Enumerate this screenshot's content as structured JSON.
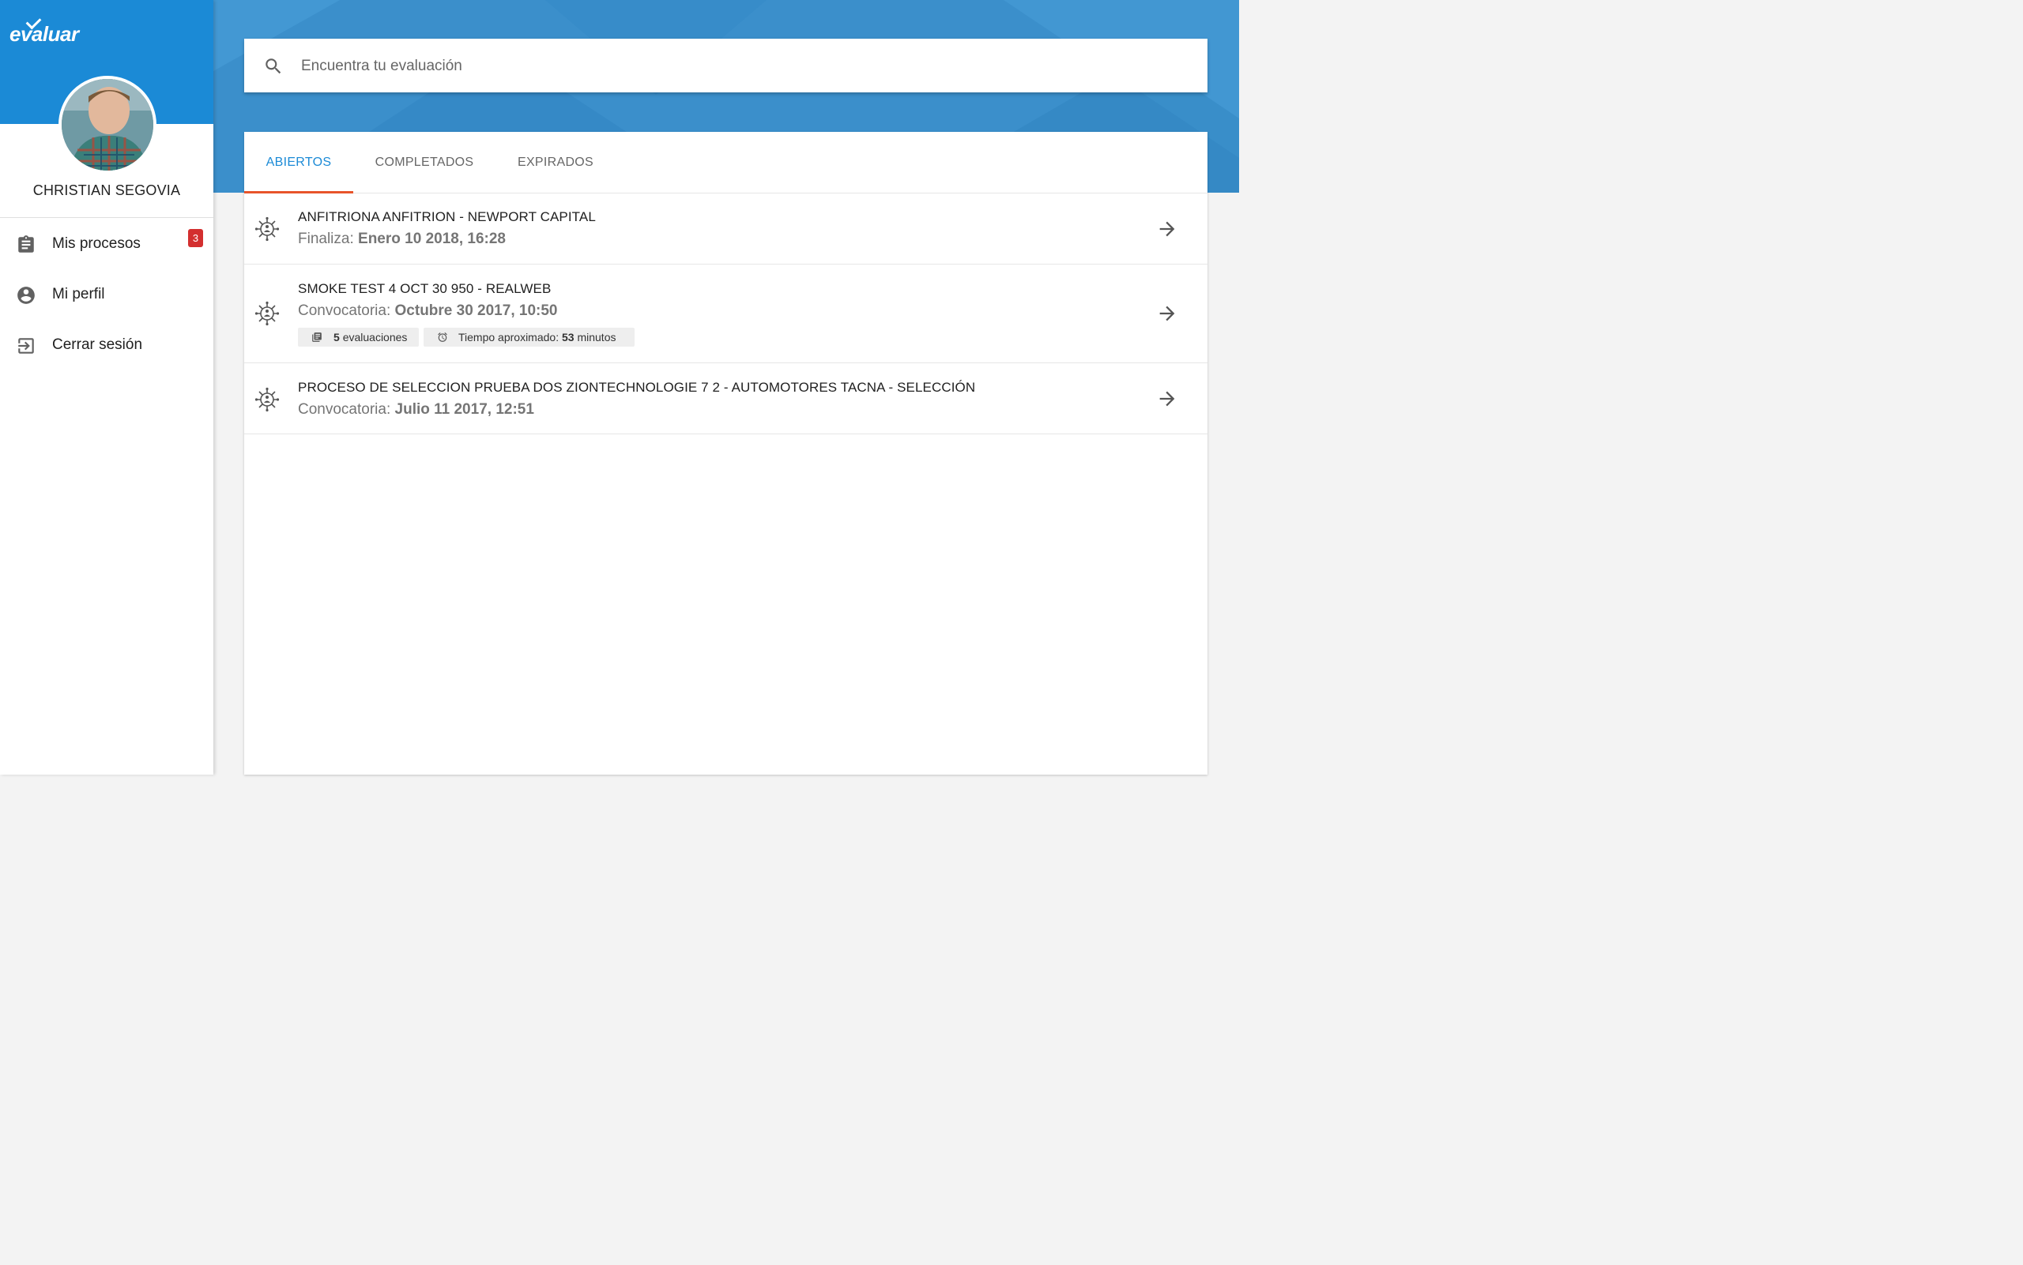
{
  "brand": {
    "logo_text": "evaluar",
    "accent": "#1b8ad6",
    "tab_indicator": "#e8542a",
    "badge_color": "#d32f2f"
  },
  "user": {
    "name": "CHRISTIAN SEGOVIA"
  },
  "sidebar": {
    "items": [
      {
        "label": "Mis procesos",
        "icon": "clipboard-icon",
        "badge": "3"
      },
      {
        "label": "Mi perfil",
        "icon": "account-circle-icon"
      },
      {
        "label": "Cerrar sesión",
        "icon": "exit-icon"
      }
    ]
  },
  "search": {
    "placeholder": "Encuentra tu evaluación",
    "value": ""
  },
  "tabs": [
    {
      "label": "ABIERTOS",
      "active": true
    },
    {
      "label": "COMPLETADOS",
      "active": false
    },
    {
      "label": "EXPIRADOS",
      "active": false
    }
  ],
  "processes": [
    {
      "title": "ANFITRIONA ANFITRION - NEWPORT CAPITAL",
      "date_label": "Finaliza:",
      "date_value": "Enero 10 2018, 16:28"
    },
    {
      "title": "SMOKE TEST 4 OCT 30 950 - REALWEB",
      "date_label": "Convocatoria:",
      "date_value": "Octubre 30 2017, 10:50",
      "eval_count": "5",
      "eval_label": "evaluaciones",
      "time_label": "Tiempo aproximado:",
      "time_value": "53",
      "time_unit": "minutos"
    },
    {
      "title": "PROCESO DE SELECCION PRUEBA DOS ZIONTECHNOLOGIE 7 2 - AUTOMOTORES TACNA - SELECCIÓN",
      "date_label": "Convocatoria:",
      "date_value": "Julio 11 2017, 12:51"
    }
  ]
}
